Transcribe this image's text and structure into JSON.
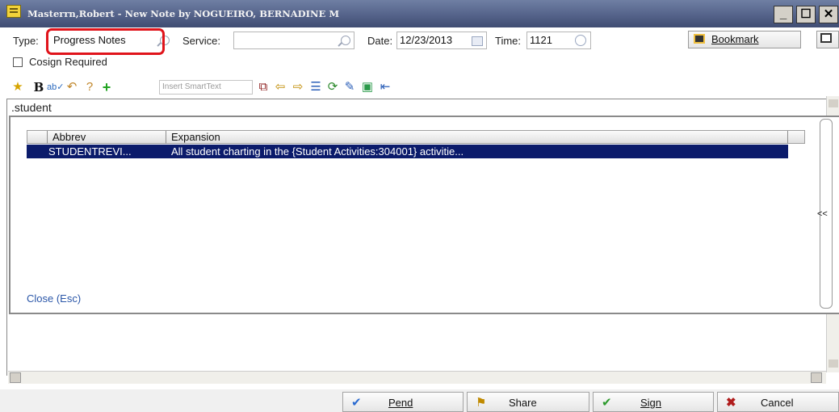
{
  "window": {
    "title": "Masterrn,Robert - New Note by NOGUEIRO, BERNADINE M",
    "buttons": {
      "minimize": "_",
      "restore": "☐",
      "close": "✕"
    }
  },
  "header": {
    "type_label": "Type:",
    "type_value": "Progress Notes",
    "service_label": "Service:",
    "service_value": "",
    "date_label": "Date:",
    "date_value": "12/23/2013",
    "time_label": "Time:",
    "time_value": "1121",
    "bookmark_label": "Bookmark",
    "cosign_label": "Cosign Required"
  },
  "toolbar": {
    "smarttext_placeholder": "Insert SmartText",
    "icons": [
      "favorites-icon",
      "bold-icon",
      "spellcheck-icon",
      "undo-icon",
      "help-icon",
      "add-icon",
      "smarttext-input",
      "link-icon",
      "back-icon",
      "forward-icon",
      "list-icon",
      "refresh-icon",
      "edit-icon",
      "image-icon",
      "insert-icon"
    ]
  },
  "editor": {
    "text": ".student"
  },
  "popup": {
    "columns": [
      "Abbrev",
      "Expansion"
    ],
    "rows": [
      {
        "abbrev": "STUDENTREVI...",
        "expansion": "All student charting in the {Student Activities:304001} activitie..."
      }
    ],
    "close_label": "Close (Esc)",
    "side_toggle": "<<"
  },
  "footer": {
    "pend": "Pend",
    "share": "Share",
    "sign": "Sign",
    "cancel": "Cancel"
  }
}
